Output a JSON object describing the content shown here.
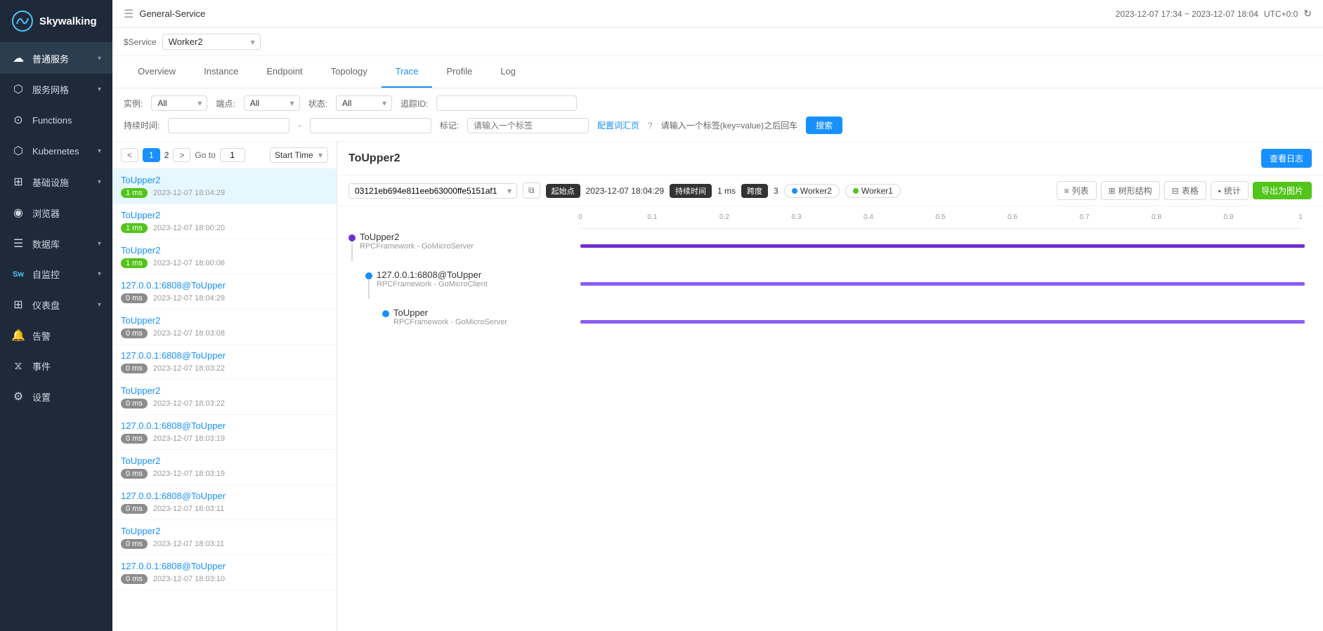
{
  "app": {
    "title": "General-Service",
    "window_title": "General-Service",
    "logo": "Skywalking",
    "datetime": "2023-12-07 17:34 ~ 2023-12-07 18:04",
    "timezone": "UTC+0:0"
  },
  "sidebar": {
    "items": [
      {
        "id": "normal-service",
        "label": "普通服务",
        "icon": "☁",
        "hasChevron": true,
        "active": true
      },
      {
        "id": "service-mesh",
        "label": "服务网格",
        "icon": "◫",
        "hasChevron": true
      },
      {
        "id": "functions",
        "label": "Functions",
        "icon": "⊙",
        "hasChevron": false
      },
      {
        "id": "kubernetes",
        "label": "Kubernetes",
        "icon": "⬡",
        "hasChevron": true
      },
      {
        "id": "infrastructure",
        "label": "基础设施",
        "icon": "⊞",
        "hasChevron": true
      },
      {
        "id": "browser",
        "label": "浏览器",
        "icon": "◉",
        "hasChevron": false
      },
      {
        "id": "database",
        "label": "数据库",
        "icon": "☰",
        "hasChevron": true
      },
      {
        "id": "self-monitor",
        "label": "自监控",
        "icon": "Sw",
        "hasChevron": true
      },
      {
        "id": "dashboard",
        "label": "仪表盘",
        "icon": "⊞",
        "hasChevron": true
      },
      {
        "id": "alert",
        "label": "告警",
        "icon": "🔔",
        "hasChevron": false
      },
      {
        "id": "events",
        "label": "事件",
        "icon": "⧖",
        "hasChevron": false
      },
      {
        "id": "settings",
        "label": "设置",
        "icon": "⚙",
        "hasChevron": false
      }
    ]
  },
  "topbar": {
    "service_label": "$Service",
    "service_value": "Worker2",
    "datetime": "2023-12-07 17:34 ~ 2023-12-07 18:04",
    "timezone": "UTC+0:0"
  },
  "tabs": [
    {
      "id": "overview",
      "label": "Overview"
    },
    {
      "id": "instance",
      "label": "Instance"
    },
    {
      "id": "endpoint",
      "label": "Endpoint"
    },
    {
      "id": "topology",
      "label": "Topology"
    },
    {
      "id": "trace",
      "label": "Trace",
      "active": true
    },
    {
      "id": "profile",
      "label": "Profile"
    },
    {
      "id": "log",
      "label": "Log"
    }
  ],
  "filters": {
    "instance_label": "实例:",
    "instance_value": "All",
    "endpoint_label": "端点:",
    "endpoint_value": "All",
    "status_label": "状态:",
    "status_value": "All",
    "traceid_label": "追踪ID:",
    "traceid_placeholder": "",
    "duration_label": "持续时间:",
    "duration_placeholder1": "",
    "duration_placeholder2": "",
    "dash": "-",
    "tag_label": "标记:",
    "tag_placeholder": "请输入一个标签",
    "config_link": "配置词汇页",
    "help_hint": "请输入一个标签(key=value)之后回车",
    "search_btn": "搜索"
  },
  "list": {
    "page_prev": "<",
    "page_current": "1",
    "page_next": "2",
    "page_next_arrow": ">",
    "goto_label": "Go to",
    "goto_value": "1",
    "sort_options": [
      "Start Time"
    ],
    "sort_selected": "Start Time",
    "items": [
      {
        "title": "ToUpper2",
        "badge": "1 ms",
        "badge_type": "1ms",
        "time": "2023-12-07 18:04:29",
        "selected": true
      },
      {
        "title": "ToUpper2",
        "badge": "1 ms",
        "badge_type": "1ms",
        "time": "2023-12-07 18:00:20"
      },
      {
        "title": "ToUpper2",
        "badge": "1 ms",
        "badge_type": "1ms",
        "time": "2023-12-07 18:00:06"
      },
      {
        "title": "127.0.0.1:6808@ToUpper",
        "badge": "0 ms",
        "badge_type": "0ms",
        "time": "2023-12-07 18:04:29"
      },
      {
        "title": "ToUpper2",
        "badge": "0 ms",
        "badge_type": "0ms",
        "time": "2023-12-07 18:03:08"
      },
      {
        "title": "127.0.0.1:6808@ToUpper",
        "badge": "0 ms",
        "badge_type": "0ms",
        "time": "2023-12-07 18:03:22"
      },
      {
        "title": "ToUpper2",
        "badge": "0 ms",
        "badge_type": "0ms",
        "time": "2023-12-07 18:03:22"
      },
      {
        "title": "127.0.0.1:6808@ToUpper",
        "badge": "0 ms",
        "badge_type": "0ms",
        "time": "2023-12-07 18:03:19"
      },
      {
        "title": "ToUpper2",
        "badge": "0 ms",
        "badge_type": "0ms",
        "time": "2023-12-07 18:03:19"
      },
      {
        "title": "127.0.0.1:6808@ToUpper",
        "badge": "0 ms",
        "badge_type": "0ms",
        "time": "2023-12-07 18:03:11"
      },
      {
        "title": "ToUpper2",
        "badge": "0 ms",
        "badge_type": "0ms",
        "time": "2023-12-07 18:03:11"
      },
      {
        "title": "127.0.0.1:6808@ToUpper",
        "badge": "0 ms",
        "badge_type": "0ms",
        "time": "2023-12-07 18:03:10"
      }
    ]
  },
  "detail": {
    "title": "ToUpper2",
    "view_log_btn": "查看日志",
    "trace_id": "03121eb694e811eeb63000ffe5151af1",
    "start_time_label": "起始点",
    "start_time": "2023-12-07 18:04:29",
    "duration_label": "持续时间",
    "duration": "1 ms",
    "span_count_label": "跨度",
    "span_count": "3",
    "services": [
      {
        "name": "Worker2",
        "dot_type": "blue"
      },
      {
        "name": "Worker1",
        "dot_type": "green"
      }
    ],
    "view_modes": [
      {
        "id": "list",
        "label": "列表",
        "icon": "≡"
      },
      {
        "id": "tree",
        "label": "树形结构",
        "icon": "⊞"
      },
      {
        "id": "table",
        "label": "表格",
        "icon": "⊟"
      },
      {
        "id": "stats",
        "label": "统计",
        "icon": "⬛"
      }
    ],
    "export_btn": "导出为图片",
    "spans": [
      {
        "name": "ToUpper2",
        "sub": "RPCFramework - GoMicroServer",
        "dot_type": "purple",
        "indent": 0,
        "bar_left_pct": 0,
        "bar_width_pct": 99,
        "bar_type": "purple"
      },
      {
        "name": "127.0.0.1:6808@ToUpper",
        "sub": "RPCFramework - GoMicroClient",
        "dot_type": "blue",
        "indent": 1,
        "bar_left_pct": 0,
        "bar_width_pct": 99,
        "bar_type": "purple"
      },
      {
        "name": "ToUpper",
        "sub": "RPCFramework - GoMicroServer",
        "dot_type": "blue",
        "indent": 2,
        "bar_left_pct": 0,
        "bar_width_pct": 99,
        "bar_type": "purple"
      }
    ],
    "ruler_ticks": [
      "0",
      "0.1",
      "0.2",
      "0.3",
      "0.4",
      "0.5",
      "0.6",
      "0.7",
      "0.8",
      "0.9",
      "1"
    ]
  }
}
